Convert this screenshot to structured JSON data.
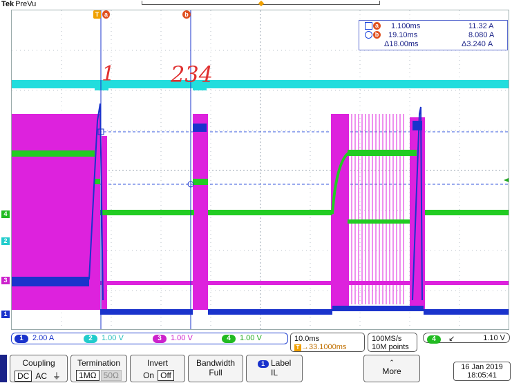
{
  "header": {
    "brand": "Tek",
    "mode": "PreVu"
  },
  "annotations": {
    "mark_1": "1",
    "mark_234": "234"
  },
  "cursors": {
    "a": {
      "label": "a",
      "time": "1.100ms",
      "value": "11.32 A"
    },
    "b": {
      "label": "b",
      "time": "19.10ms",
      "value": "8.080 A"
    },
    "delta_time": "Δ18.00ms",
    "delta_value": "Δ3.240 A"
  },
  "channel_markers": [
    {
      "id": "4",
      "color": "#22bb22"
    },
    {
      "id": "2",
      "color": "#22cccc"
    },
    {
      "id": "3",
      "color": "#cc22cc"
    },
    {
      "id": "1",
      "color": "#1a33cc"
    }
  ],
  "channels": [
    {
      "num": "1",
      "scale": "2.00 A",
      "color": "#1a33cc"
    },
    {
      "num": "2",
      "scale": "1.00 V",
      "color": "#22cccc"
    },
    {
      "num": "3",
      "scale": "1.00 V",
      "color": "#cc22cc"
    },
    {
      "num": "4",
      "scale": "1.00 V",
      "color": "#22bb22"
    }
  ],
  "timebase": {
    "scale": "10.0ms",
    "trigger_pos": "→33.1000ms"
  },
  "acquisition": {
    "rate": "100MS/s",
    "points": "10M points"
  },
  "trigger": {
    "channel": "4",
    "slope": "↙",
    "level": "1.10 V"
  },
  "softkeys": {
    "coupling": {
      "title": "Coupling",
      "options": [
        "DC",
        "AC",
        "⏚"
      ]
    },
    "termination": {
      "title": "Termination",
      "options": [
        "1MΩ",
        "50Ω"
      ]
    },
    "invert": {
      "title": "Invert",
      "options": [
        "On",
        "Off"
      ]
    },
    "bandwidth": {
      "title": "Bandwidth",
      "value": "Full"
    },
    "label": {
      "title": "Label",
      "value": "IL",
      "channel": "1"
    },
    "more": {
      "title": "More"
    }
  },
  "datetime": {
    "date": "16 Jan  2019",
    "time": "18:05:41"
  },
  "colors": {
    "ch1": "#1a33cc",
    "ch2": "#22dddd",
    "ch3": "#dd22dd",
    "ch4": "#22cc22",
    "grid": "#b8c0c8",
    "readout_border": "#5a6bd0"
  }
}
